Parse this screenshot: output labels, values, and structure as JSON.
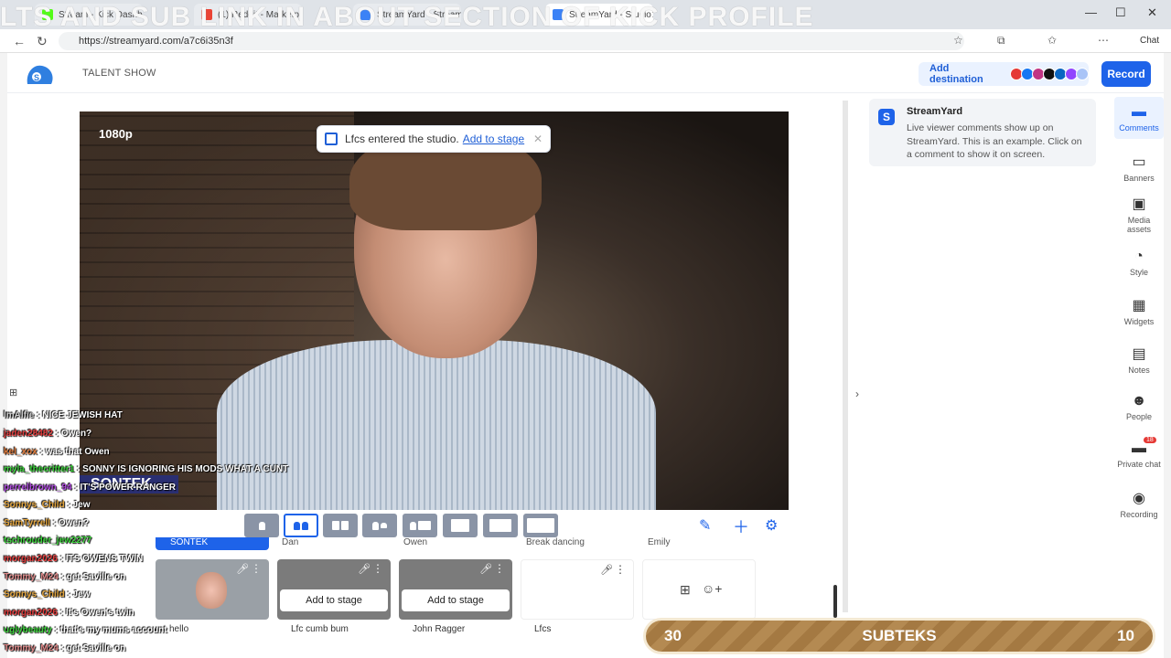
{
  "browser": {
    "overlay_title": "LTS AND SUB LINK IN ABOUT SECTION OF KICK PROFILE",
    "tabs": [
      {
        "label": "Stream - Kick Dashboard",
        "color": "#53fc18"
      },
      {
        "label": "(1) Reddit - Marketplace",
        "color": "#ea4335"
      },
      {
        "label": "StreamYard - Stream",
        "color": "#3b82f6"
      },
      {
        "label": "StreamYard - Studio",
        "color": "#3b82f6"
      }
    ],
    "url": "https://streamyard.com/a7c6i35n3f",
    "chat_label": "Chat"
  },
  "app": {
    "studio_name": "TALENT SHOW",
    "add_destination_label": "Add destination",
    "record_label": "Record",
    "resolution": "1080p",
    "toast": {
      "message": "Lfcs entered the studio.",
      "link": "Add to stage"
    }
  },
  "guests": [
    {
      "top_label": "SONTEK",
      "name": "hello"
    },
    {
      "top_label": "Dan",
      "name": "Lfc cumb bum",
      "button": "Add to stage"
    },
    {
      "top_label": "Owen",
      "name": "John Ragger",
      "button": "Add to stage"
    },
    {
      "top_label": "Break dancing",
      "name": "Lfcs"
    },
    {
      "top_label": "Emily"
    }
  ],
  "chat_overlay": {
    "sontek_banner": "SONTEK",
    "messages": [
      {
        "user": "lmAlfie",
        "text": "NICE JEWISH HAT",
        "color": "#cfcfcf"
      },
      {
        "user": "jaden28482",
        "text": "Owen?",
        "color": "#e03a3a"
      },
      {
        "user": "kel_xox",
        "text": "was that Owen",
        "color": "#e07a3a"
      },
      {
        "user": "myla_thecritter1",
        "text": "SONNY IS IGNORING HIS MODS WHAT A CUNT",
        "color": "#3ad13a"
      },
      {
        "user": "perrelbrown_94",
        "text": "IT'S POWER RANGER",
        "color": "#b04ae0"
      },
      {
        "user": "Sonnys_Child",
        "text": "Jew",
        "color": "#e0a23a"
      },
      {
        "user": "SamTyrrell",
        "text": "Owen?",
        "color": "#e0a23a"
      },
      {
        "user": "tschrouder_jew2277",
        "text": "",
        "color": "#3ad13a"
      },
      {
        "user": "morgan2026",
        "text": "ITS OWENS TWIN",
        "color": "#e03a3a"
      },
      {
        "user": "Tommy_M24",
        "text": "get Saville on",
        "color": "#e08a8a"
      },
      {
        "user": "Sonnys_Child",
        "text": "Jew",
        "color": "#e0a23a"
      },
      {
        "user": "morgan2026",
        "text": "It's Owen's twin",
        "color": "#e03a3a"
      },
      {
        "user": "uglybeauty",
        "text": "that's my mums account",
        "color": "#3ad13a"
      },
      {
        "user": "Tommy_M24",
        "text": "get Saville on",
        "color": "#e08a8a"
      }
    ]
  },
  "comments_panel": {
    "title": "StreamYard",
    "body": "Live viewer comments show up on StreamYard. This is an example. Click on a comment to show it on screen."
  },
  "sidebar": [
    {
      "label": "Comments",
      "icon": "comment-icon",
      "glyph": "▬"
    },
    {
      "label": "Banners",
      "icon": "banner-icon",
      "glyph": "▭"
    },
    {
      "label": "Media assets",
      "icon": "media-icon",
      "glyph": "▣"
    },
    {
      "label": "Style",
      "icon": "palette-icon",
      "glyph": "◔"
    },
    {
      "label": "Widgets",
      "icon": "widgets-icon",
      "glyph": "▦"
    },
    {
      "label": "Notes",
      "icon": "notes-icon",
      "glyph": "▤"
    },
    {
      "label": "People",
      "icon": "people-icon",
      "glyph": "☻"
    },
    {
      "label": "Private chat",
      "icon": "private-chat-icon",
      "glyph": "▬",
      "badge": "18"
    },
    {
      "label": "Recording",
      "icon": "record-icon",
      "glyph": "◉"
    }
  ],
  "subteks": {
    "left": "30",
    "center": "SUBTEKS",
    "right": "10"
  }
}
